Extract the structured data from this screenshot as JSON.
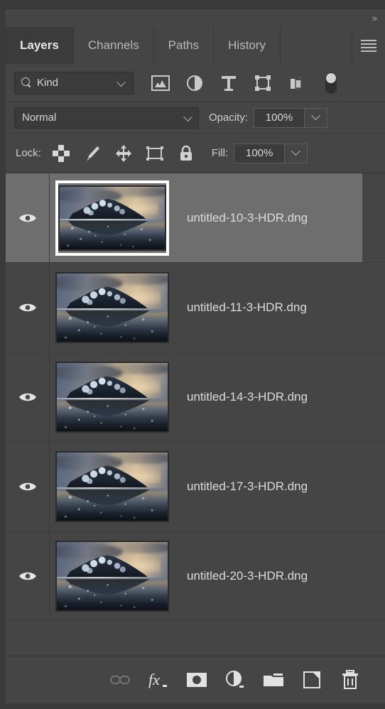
{
  "panel": {
    "collapse_icon": "chevron-double-right-icon",
    "collapse_glyph": "»",
    "menu_icon": "panel-menu-icon"
  },
  "tabs": [
    {
      "label": "Layers",
      "name": "tab-layers",
      "active": true
    },
    {
      "label": "Channels",
      "name": "tab-channels",
      "active": false
    },
    {
      "label": "Paths",
      "name": "tab-paths",
      "active": false
    },
    {
      "label": "History",
      "name": "tab-history",
      "active": false
    }
  ],
  "filter": {
    "search_icon": "search-icon",
    "kind_label": "Kind",
    "caret_icon": "chevron-down-icon",
    "icons": [
      {
        "name": "filter-pixel-layers-icon",
        "title": "Pixel layers"
      },
      {
        "name": "filter-adjustment-layers-icon",
        "title": "Adjustment layers"
      },
      {
        "name": "filter-type-layers-icon",
        "title": "Type layers"
      },
      {
        "name": "filter-shape-layers-icon",
        "title": "Shape layers"
      },
      {
        "name": "filter-smart-object-icon",
        "title": "Smart objects"
      }
    ],
    "toggle_name": "filter-enable-toggle",
    "toggle_on": true
  },
  "blend": {
    "mode": "Normal",
    "caret_icon": "chevron-down-icon",
    "opacity_label": "Opacity:",
    "opacity_value": "100%",
    "opacity_caret_icon": "chevron-down-icon"
  },
  "lock": {
    "label": "Lock:",
    "icons": [
      {
        "name": "lock-transparent-pixels-icon",
        "title": "Lock transparent pixels"
      },
      {
        "name": "lock-image-pixels-icon",
        "title": "Lock image pixels"
      },
      {
        "name": "lock-position-icon",
        "title": "Lock position"
      },
      {
        "name": "lock-artboard-nesting-icon",
        "title": "Prevent auto-nesting"
      },
      {
        "name": "lock-all-icon",
        "title": "Lock all"
      }
    ],
    "fill_label": "Fill:",
    "fill_value": "100%",
    "fill_caret_icon": "chevron-down-icon"
  },
  "layers": [
    {
      "name": "untitled-10-3-HDR.dng",
      "visible": true,
      "selected": true
    },
    {
      "name": "untitled-11-3-HDR.dng",
      "visible": true,
      "selected": false
    },
    {
      "name": "untitled-14-3-HDR.dng",
      "visible": true,
      "selected": false
    },
    {
      "name": "untitled-17-3-HDR.dng",
      "visible": true,
      "selected": false
    },
    {
      "name": "untitled-20-3-HDR.dng",
      "visible": true,
      "selected": false
    }
  ],
  "bottom_toolbar": [
    {
      "name": "link-layers-icon",
      "title": "Link layers",
      "disabled": true
    },
    {
      "name": "layer-style-fx-icon",
      "title": "Add a layer style",
      "disabled": false
    },
    {
      "name": "add-layer-mask-icon",
      "title": "Add layer mask",
      "disabled": false
    },
    {
      "name": "new-adjustment-layer-icon",
      "title": "New adjustment layer",
      "disabled": false
    },
    {
      "name": "new-group-icon",
      "title": "Create a new group",
      "disabled": false
    },
    {
      "name": "new-layer-icon",
      "title": "Create a new layer",
      "disabled": false
    },
    {
      "name": "delete-layer-icon",
      "title": "Delete layer",
      "disabled": false
    }
  ],
  "colors": {
    "panel_bg": "#454545",
    "window_bg": "#3a3a3a",
    "active_tab_bg": "#3b3b3b",
    "selected_row_bg": "#6e6e6e",
    "text": "#dcdcdc",
    "icon": "#c9c9c9"
  }
}
